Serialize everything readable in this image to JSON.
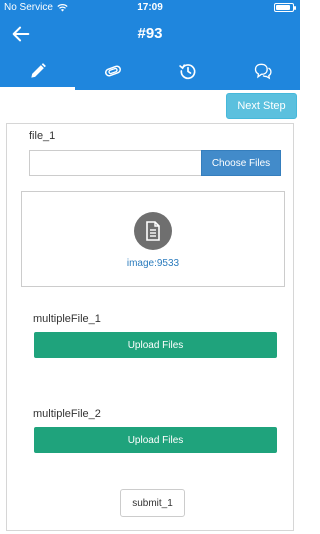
{
  "status_bar": {
    "carrier": "No Service",
    "time": "17:09"
  },
  "header": {
    "title": "#93"
  },
  "tabs": [
    {
      "icon": "pencil-icon",
      "active": true
    },
    {
      "icon": "paperclip-icon",
      "active": false
    },
    {
      "icon": "history-icon",
      "active": false
    },
    {
      "icon": "chat-icon",
      "active": false
    }
  ],
  "toolbar": {
    "next_step_label": "Next Step"
  },
  "form": {
    "file_1": {
      "label": "file_1",
      "choose_label": "Choose Files",
      "value": ""
    },
    "preview": {
      "icon": "document-icon",
      "filename": "image:9533"
    },
    "multiple_file_1": {
      "label": "multipleFile_1",
      "button_label": "Upload Files"
    },
    "multiple_file_2": {
      "label": "multipleFile_2",
      "button_label": "Upload Files"
    },
    "submit_label": "submit_1"
  },
  "colors": {
    "primary": "#1f86dd",
    "info": "#5bc0de",
    "success": "#1fa37c",
    "choose": "#428bca"
  }
}
